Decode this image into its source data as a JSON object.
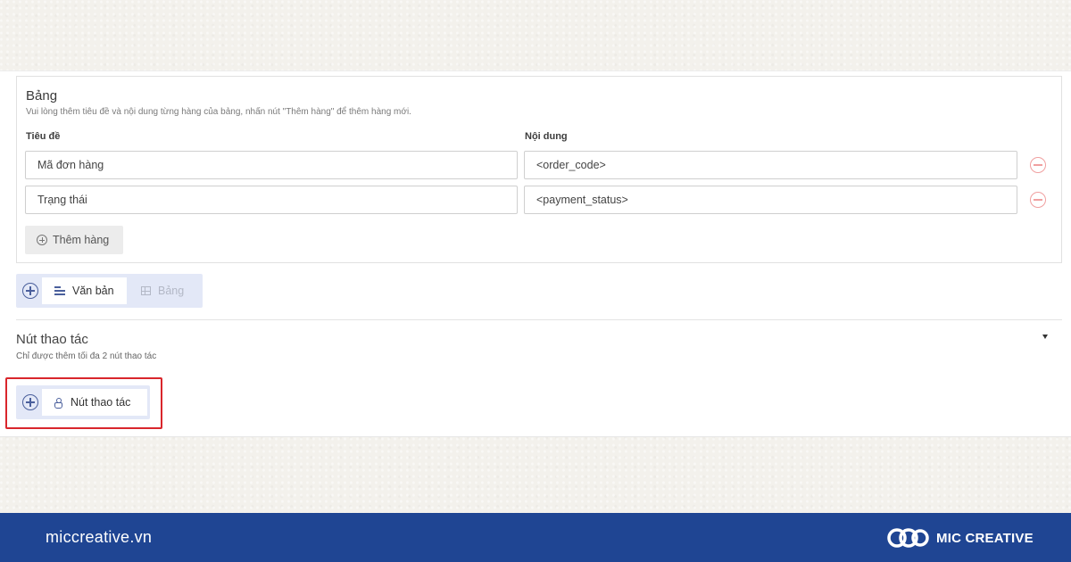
{
  "table_block": {
    "title": "Bảng",
    "description": "Vui lòng thêm tiêu đề và nội dung từng hàng của bảng, nhấn nút \"Thêm hàng\" để thêm hàng mới.",
    "column_headers": [
      "Tiêu đề",
      "Nội dung"
    ],
    "rows": [
      {
        "title": "Mã đơn hàng",
        "content": "<order_code>"
      },
      {
        "title": "Trạng thái",
        "content": "<payment_status>"
      }
    ],
    "add_row_label": "Thêm hàng"
  },
  "block_toolbar": {
    "text_label": "Văn bản",
    "table_label": "Bảng"
  },
  "action_section": {
    "title": "Nút thao tác",
    "description": "Chỉ được thêm tối đa 2 nút thao tác",
    "action_button_label": "Nút thao tác"
  },
  "footer": {
    "website": "miccreative.vn",
    "brand": "MIC CREATIVE"
  },
  "colors": {
    "footer_bg": "#1f4593",
    "highlight": "#d9262c",
    "remove_icon": "#f0a0a0",
    "toolbar_bg": "#e3e8f7"
  },
  "icons": [
    "remove-circle-icon",
    "plus-circle-icon",
    "text-icon",
    "table-icon",
    "hand-pointer-icon",
    "chevron-down-icon",
    "mic-logo-icon"
  ]
}
